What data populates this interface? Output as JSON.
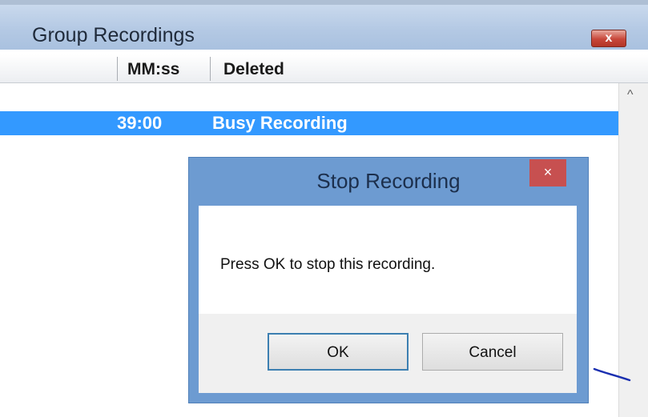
{
  "window": {
    "title": "Group Recordings",
    "close_label": "x"
  },
  "columns": [
    "MM:ss",
    "Deleted"
  ],
  "rows": [
    {
      "time": "39:00",
      "status": "Busy Recording",
      "selected": true
    }
  ],
  "scrollbar": {
    "up_arrow": "^"
  },
  "dialog": {
    "title": "Stop Recording",
    "close_label": "×",
    "message": "Press OK to stop this recording.",
    "ok_label": "OK",
    "cancel_label": "Cancel"
  },
  "colors": {
    "selection": "#3399ff",
    "dialog_frame": "#6d9bd1",
    "dialog_close": "#c75050"
  }
}
